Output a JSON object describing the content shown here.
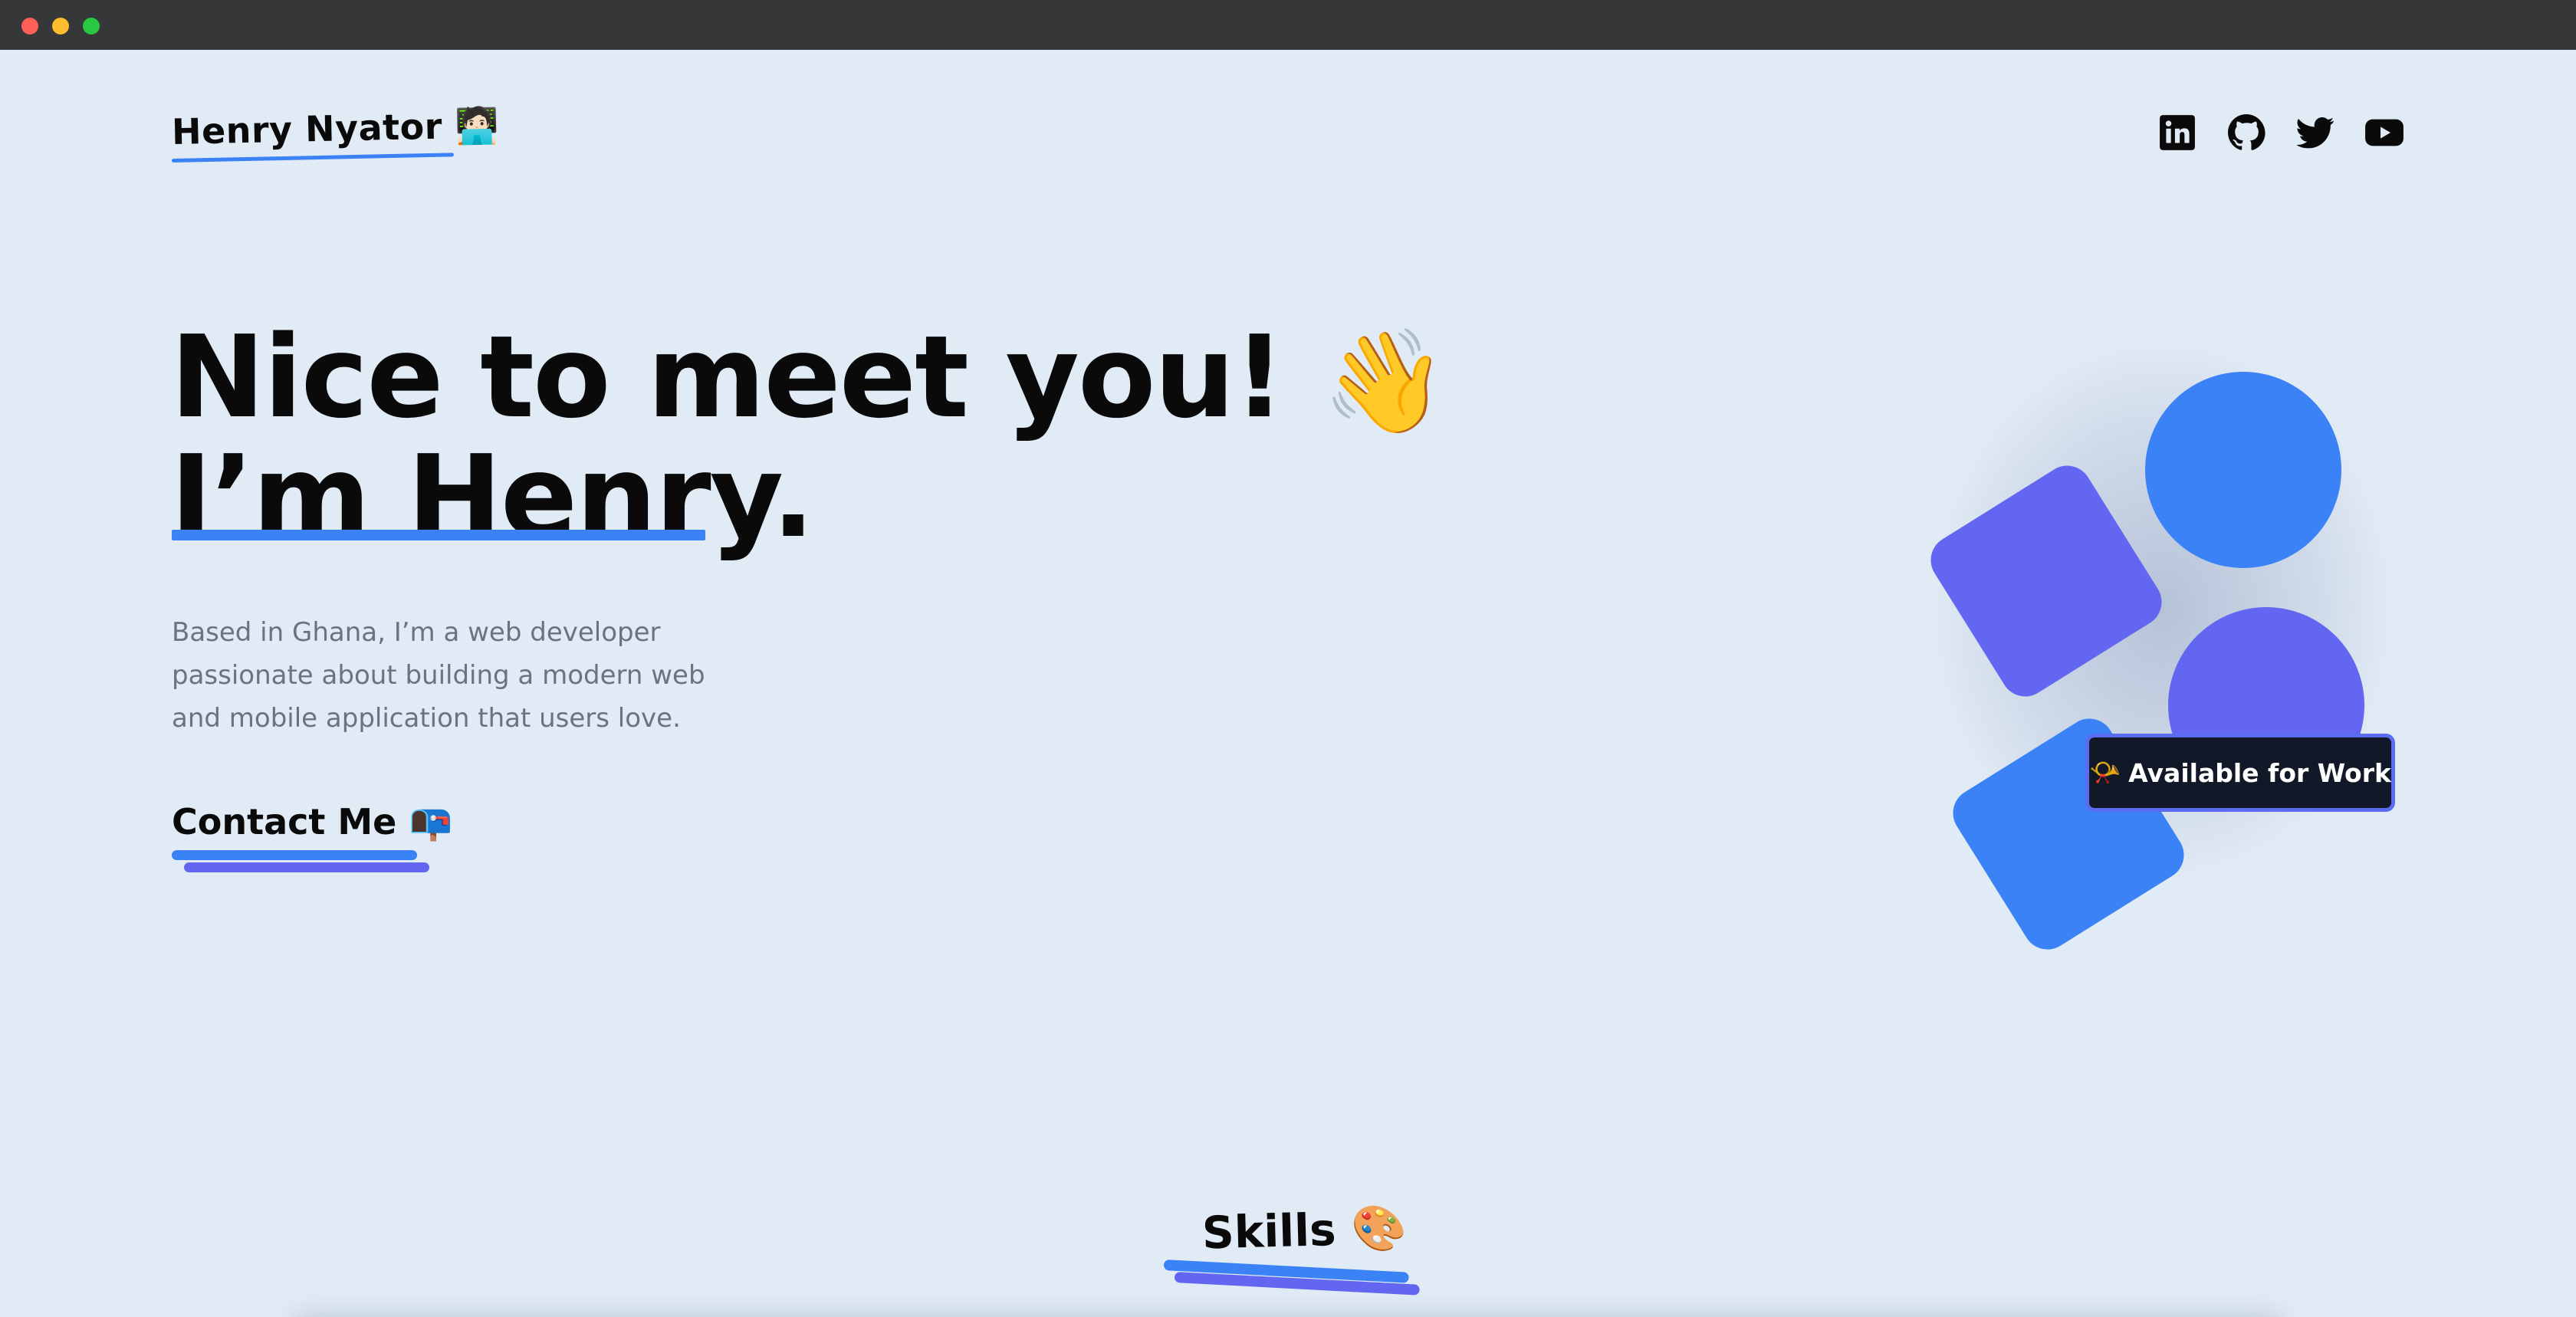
{
  "brand": {
    "name": "Henry Nyator",
    "emoji": "🧑🏻‍💻"
  },
  "socials": [
    {
      "name": "LinkedIn",
      "icon": "linkedin-icon"
    },
    {
      "name": "GitHub",
      "icon": "github-icon"
    },
    {
      "name": "Twitter",
      "icon": "twitter-icon"
    },
    {
      "name": "YouTube",
      "icon": "youtube-icon"
    }
  ],
  "hero": {
    "line1": "Nice to meet you!",
    "wave_emoji": "👋",
    "line2": "I’m Henry.",
    "intro": "Based in Ghana, I’m a web developer passionate about building a modern web and mobile application that users love."
  },
  "contact": {
    "label": "Contact Me",
    "emoji": "📭"
  },
  "badge": {
    "emoji": "📯",
    "label": "Available for Work"
  },
  "skills": {
    "title": "Skills",
    "emoji": "🎨"
  },
  "colors": {
    "background": "#e1ebf5",
    "blue": "#3b82f6",
    "indigo": "#6366f1",
    "badge_bg": "#111827",
    "text": "#0a0a0a",
    "muted_text": "#6b7280"
  }
}
